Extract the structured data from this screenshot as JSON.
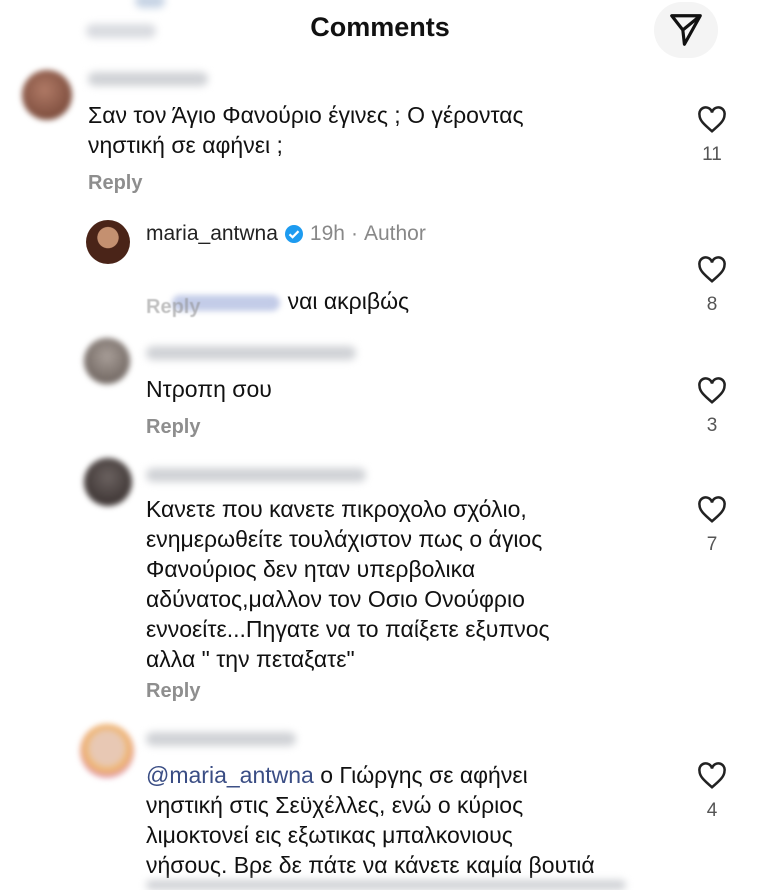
{
  "header": {
    "title": "Comments",
    "share_icon": "send-icon"
  },
  "comments": [
    {
      "text": "Σαν τον Άγιο Φανούριο έγινες ; Ο γέροντας\nνηστική σε αφήνει ;",
      "reply": "Reply",
      "likes": "11"
    },
    {
      "username": "maria_antwna",
      "time": "19h",
      "separator": "·",
      "tag": "Author",
      "text": "ναι ακριβώς",
      "reply": "Reply",
      "likes": "8"
    },
    {
      "text": "Ντροπη σου",
      "reply": "Reply",
      "likes": "3"
    },
    {
      "text": "Κανετε που κανετε πικροχολο σχόλιο,\nενημερωθείτε τουλάχιστον πως ο άγιος\nΦανούριος δεν ηταν υπερβολικα\nαδύνατος,μαλλον τον Οσιο Ονούφριο\nεννοείτε...Πηγατε να το παίξετε εξυπνος\nαλλα \" την πεταξατε\"",
      "reply": "Reply",
      "likes": "7"
    },
    {
      "mention": "@maria_antwna",
      "text": " ο Γιώργης σε αφήνει\nνηστική στις Σεϋχέλλες, ενώ ο κύριος\nλιμοκτονεί εις εξωτικας μπαλκονιους\nνήσους. Βρε δε πάτε να κάνετε καμία βουτιά",
      "likes": "4"
    }
  ],
  "icons": {
    "like": "heart-outline-icon",
    "verified": "verified-badge-icon"
  },
  "colors": {
    "mention": "#3a4d84",
    "verified": "#1d9bf0",
    "reply": "#8e8e8e"
  }
}
